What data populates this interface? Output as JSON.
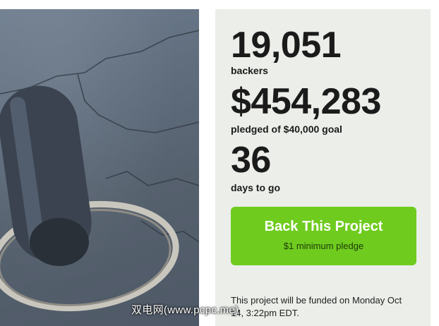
{
  "stats": {
    "backers_count": "19,051",
    "backers_label": "backers",
    "pledged_amount": "$454,283",
    "pledged_label": "pledged of $40,000 goal",
    "days_count": "36",
    "days_label": "days to go"
  },
  "cta": {
    "title": "Back This Project",
    "subtitle": "$1 minimum pledge"
  },
  "funding_note": "This project will be funded on Monday Oct 14, 3:22pm EDT.",
  "watermark": "双电网(www.pcpc.me)",
  "colors": {
    "panel_bg": "#ebeee9",
    "button_green": "#6fcc1f"
  },
  "image": {
    "subject": "keychain-with-metal-cylinder"
  }
}
